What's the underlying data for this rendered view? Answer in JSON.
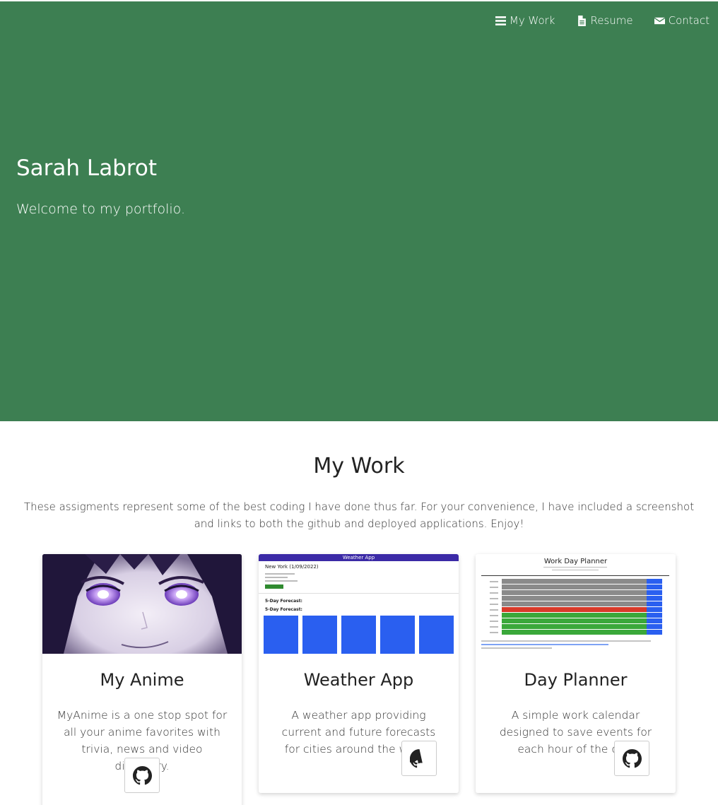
{
  "nav": {
    "items": [
      {
        "label": "My Work",
        "icon": "bars-icon"
      },
      {
        "label": "Resume",
        "icon": "file-icon"
      },
      {
        "label": "Contact",
        "icon": "envelope-icon"
      }
    ]
  },
  "hero": {
    "title": "Sarah Labrot",
    "subtitle": "Welcome to my portfolio."
  },
  "work": {
    "title": "My Work",
    "description": "These assigments represent some of the best coding I have done thus far. For your convenience, I have included a screenshot and links to both the github and deployed applications. Enjoy!"
  },
  "cards": [
    {
      "title": "My Anime",
      "text": "MyAnime is a one stop spot for all your anime favorites with trivia, news and video discovery."
    },
    {
      "title": "Weather App",
      "text": "A weather app providing current and future forecasts for cities around the world."
    },
    {
      "title": "Day Planner",
      "text": "A simple work calendar designed to save events for each hour of the day."
    }
  ],
  "screens": {
    "weather_header": "Weather App",
    "weather_city": "New York (1/09/2022)",
    "weather_forecast": "5-Day Forecast:",
    "planner_title": "Work Day Planner"
  },
  "colors": {
    "hero_bg": "#3d7f52",
    "accent_blue": "#2a5ff0",
    "planner_red": "#d83a2a",
    "planner_green": "#3aa83a"
  }
}
